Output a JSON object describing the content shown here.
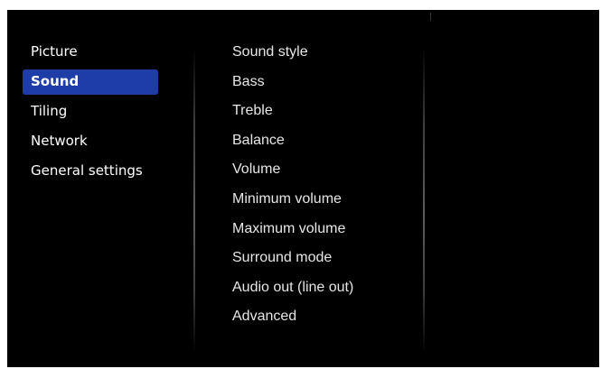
{
  "main_menu": {
    "items": [
      {
        "label": "Picture",
        "selected": false
      },
      {
        "label": "Sound",
        "selected": true
      },
      {
        "label": "Tiling",
        "selected": false
      },
      {
        "label": "Network",
        "selected": false
      },
      {
        "label": "General settings",
        "selected": false
      }
    ]
  },
  "submenu": {
    "items": [
      {
        "label": "Sound style"
      },
      {
        "label": "Bass"
      },
      {
        "label": "Treble"
      },
      {
        "label": "Balance"
      },
      {
        "label": "Volume"
      },
      {
        "label": "Minimum volume"
      },
      {
        "label": "Maximum volume"
      },
      {
        "label": "Surround mode"
      },
      {
        "label": "Audio out (line out)"
      },
      {
        "label": "Advanced"
      }
    ]
  },
  "colors": {
    "background": "#000000",
    "selection_highlight": "#1f3da6",
    "text": "#ffffff",
    "submenu_text": "#e6e6e6"
  }
}
